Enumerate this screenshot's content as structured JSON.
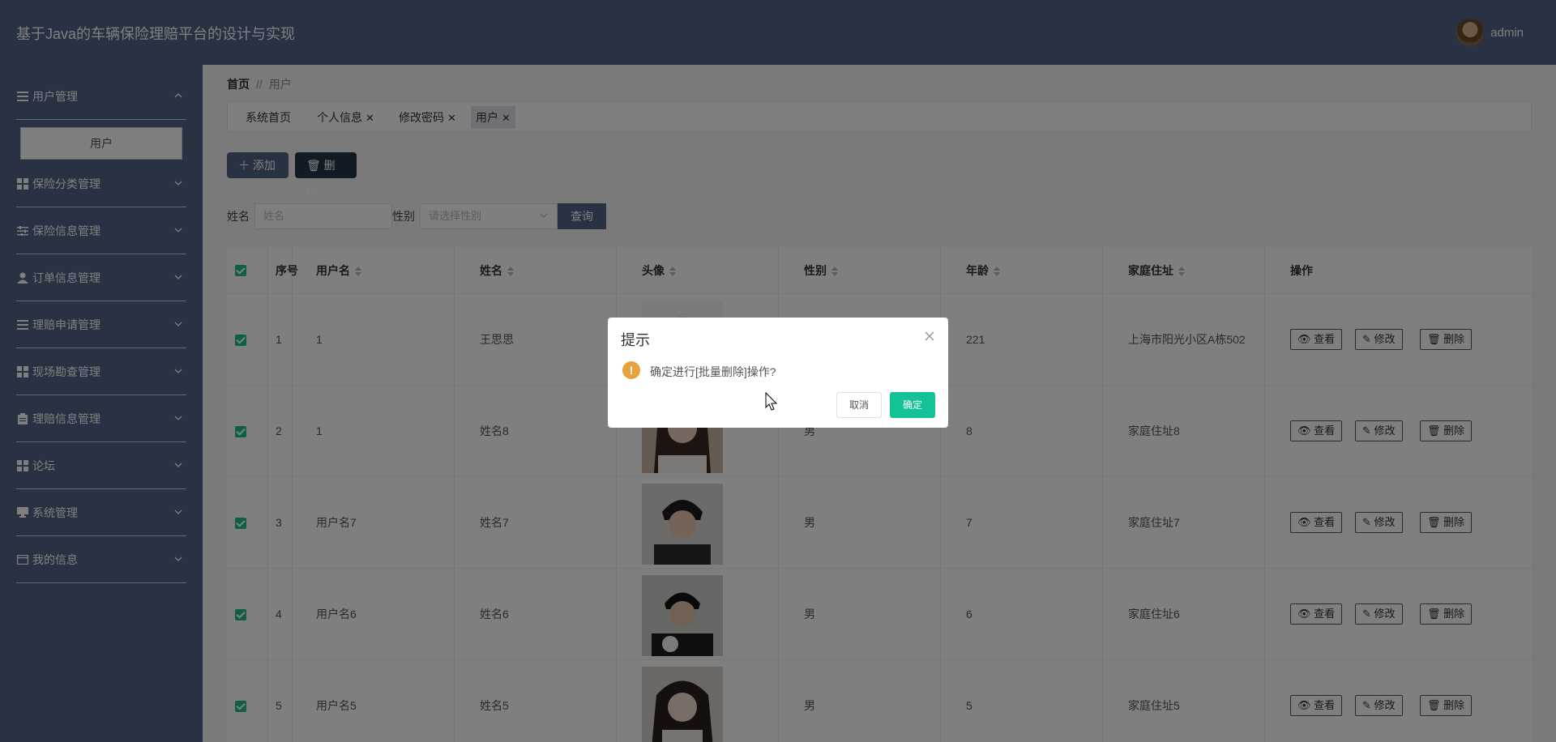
{
  "header": {
    "title": "基于Java的车辆保险理赔平台的设计与实现",
    "username": "admin"
  },
  "sidebar": {
    "items": [
      {
        "label": "用户管理",
        "icon": "list-icon",
        "expanded": true
      },
      {
        "label": "保险分类管理",
        "icon": "grid-icon"
      },
      {
        "label": "保险信息管理",
        "icon": "sliders-icon"
      },
      {
        "label": "订单信息管理",
        "icon": "user-icon"
      },
      {
        "label": "理赔申请管理",
        "icon": "list-icon"
      },
      {
        "label": "现场勘查管理",
        "icon": "grid-icon"
      },
      {
        "label": "理赔信息管理",
        "icon": "clipboard-icon"
      },
      {
        "label": "论坛",
        "icon": "grid-icon"
      },
      {
        "label": "系统管理",
        "icon": "monitor-icon"
      },
      {
        "label": "我的信息",
        "icon": "card-icon"
      }
    ],
    "submenu": "用户"
  },
  "breadcrumb": {
    "home": "首页",
    "sep": "//",
    "current": "用户"
  },
  "tabs": [
    {
      "label": "系统首页"
    },
    {
      "label": "个人信息",
      "closable": true
    },
    {
      "label": "修改密码",
      "closable": true
    },
    {
      "label": "用户",
      "closable": true,
      "active": true
    }
  ],
  "toolbar": {
    "add": "添加",
    "delete": "删除"
  },
  "search": {
    "name_label": "姓名",
    "name_placeholder": "姓名",
    "gender_label": "性别",
    "gender_placeholder": "请选择性别",
    "query": "查询"
  },
  "table": {
    "headers": [
      "序号",
      "用户名",
      "姓名",
      "头像",
      "性别",
      "年龄",
      "家庭住址",
      "操作"
    ],
    "rows": [
      {
        "index": "1",
        "username": "1",
        "name": "王思思",
        "gender": "",
        "age": "221",
        "address": "上海市阳光小区A栋502"
      },
      {
        "index": "2",
        "username": "1",
        "name": "姓名8",
        "gender": "男",
        "age": "8",
        "address": "家庭住址8"
      },
      {
        "index": "3",
        "username": "用户名7",
        "name": "姓名7",
        "gender": "男",
        "age": "7",
        "address": "家庭住址7"
      },
      {
        "index": "4",
        "username": "用户名6",
        "name": "姓名6",
        "gender": "男",
        "age": "6",
        "address": "家庭住址6"
      },
      {
        "index": "5",
        "username": "用户名5",
        "name": "姓名5",
        "gender": "男",
        "age": "5",
        "address": "家庭住址5"
      }
    ],
    "actions": {
      "view": "查看",
      "edit": "修改",
      "delete": "删除"
    }
  },
  "dialog": {
    "title": "提示",
    "message": "确定进行[批量删除]操作?",
    "cancel": "取消",
    "confirm": "确定"
  },
  "colors": {
    "primary": "#526484",
    "dark": "#253449",
    "success": "#13c296",
    "warning": "#e6a23c"
  }
}
